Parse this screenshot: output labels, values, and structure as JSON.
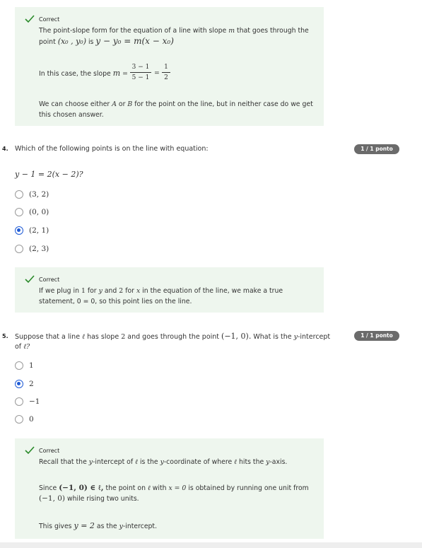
{
  "feedback_top": {
    "status": "Correct",
    "line1": "The point-slope form for the equation of a line with slope",
    "m": "m",
    "line1b": "that goes through the",
    "point_word": "point",
    "point_expr": "(x₀ , y₀)",
    "is_word": "is",
    "formula": "y − y₀ = m(x − x₀)",
    "slope_intro": "In this case, the slope",
    "slope_m": "m",
    "frac1_num": "3 − 1",
    "frac1_den": "5 − 1",
    "frac2_num": "1",
    "frac2_den": "2",
    "choose_a": "We can choose either",
    "var_a": "A",
    "or_word": "or",
    "var_b": "B",
    "choose_b": "for the point on the line, but in neither case do we get",
    "choose_c": "this chosen answer."
  },
  "q4": {
    "number": "4.",
    "text": "Which of the following points is on the line with equation:",
    "equation": "y − 1 = 2(x − 2)?",
    "badge": "1 / 1 ponto",
    "options": [
      "(3, 2)",
      "(0, 0)",
      "(2, 1)",
      "(2, 3)"
    ],
    "feedback_status": "Correct",
    "fb_a": "If we plug in",
    "fb_one": "1",
    "fb_for": "for",
    "fb_y": "y",
    "fb_and": "and",
    "fb_two": "2",
    "fb_for2": "for",
    "fb_x": "x",
    "fb_b": "in the equation of the line, we make a true",
    "fb_c": "statement, 0 = 0, so this point lies on the line."
  },
  "q5": {
    "number": "5.",
    "text_a": "Suppose that a line",
    "ell": "ℓ",
    "text_b": "has slope",
    "two": "2",
    "text_c": "and goes through the point",
    "pt": "(−1, 0).",
    "text_d": "What is the",
    "y": "y",
    "text_e": "-intercept",
    "text_f": "of",
    "ell2": "ℓ?",
    "badge": "1 / 1 ponto",
    "options": [
      "1",
      "2",
      "−1",
      "0"
    ],
    "feedback_status": "Correct",
    "fb1_a": "Recall that the",
    "fb1_y": "y",
    "fb1_b": "-intercept of",
    "fb1_ell": "ℓ",
    "fb1_c": "is the",
    "fb1_y2": "y",
    "fb1_d": "-coordinate of where",
    "fb1_ell2": "ℓ",
    "fb1_e": "hits the",
    "fb1_y3": "y",
    "fb1_f": "-axis.",
    "fb2_a": "Since",
    "fb2_expr": "(−1, 0) ∈ ℓ,",
    "fb2_b": "the point on",
    "fb2_ell": "ℓ",
    "fb2_c": "with",
    "fb2_eq": "x = 0",
    "fb2_d": "is obtained by running one unit from",
    "fb2_pt": "(−1, 0)",
    "fb2_e": "while rising two units.",
    "fb3_a": "This gives",
    "fb3_eq": "y = 2",
    "fb3_b": "as the",
    "fb3_y": "y",
    "fb3_c": "-intercept."
  }
}
